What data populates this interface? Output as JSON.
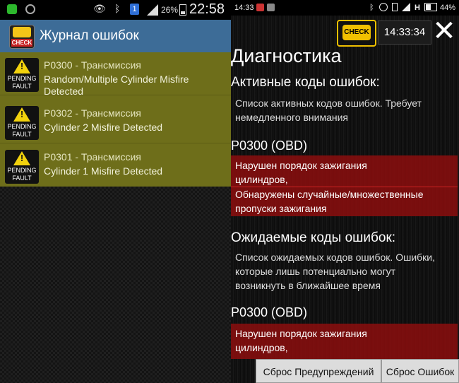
{
  "left": {
    "status_bar": {
      "icons": [
        "green-shield-icon",
        "vpn-icon",
        "eye-icon",
        "bluetooth-icon",
        "sim-icon",
        "signal-icon",
        "battery-icon"
      ],
      "sim_number": "1",
      "battery": "26%",
      "time": "22:58"
    },
    "title": "Журнал ошибок",
    "app_icon": {
      "name": "obd-car-icon",
      "label": "CHECK"
    },
    "faults": [
      {
        "code": "P0300 - Трансмиссия",
        "desc1": "Random/Multiple Cylinder Misfire",
        "desc2": "Detected",
        "badge1": "PENDING",
        "badge2": "FAULT"
      },
      {
        "code": "P0302 - Трансмиссия",
        "desc1": "Cylinder 2 Misfire Detected",
        "desc2": "",
        "badge1": "PENDING",
        "badge2": "FAULT"
      },
      {
        "code": "P0301 - Трансмиссия",
        "desc1": "Cylinder 1 Misfire Detected",
        "desc2": "",
        "badge1": "PENDING",
        "badge2": "FAULT"
      }
    ],
    "colors": {
      "titlebar": "#3d6c97",
      "fault_bg": "#6e6e1a"
    }
  },
  "right": {
    "status_bar": {
      "time": "14:33",
      "network": "H",
      "battery": "44%",
      "icons": [
        "message-icon",
        "play-icon",
        "bluetooth-icon",
        "nfc-icon",
        "vibrate-icon",
        "signal-icon",
        "battery-icon"
      ]
    },
    "check_button": "CHECK",
    "clock": "14:33:34",
    "close_symbol": "✕",
    "title": "Диагностика",
    "active_header": "Активные коды ошибок:",
    "active_text1": "Список активных кодов ошибок. Требует",
    "active_text2": "немедленного внимания",
    "code1": "P0300 (OBD)",
    "code1_lines": [
      "Нарушен порядок зажигания",
      "цилиндров,",
      "Обнаружены случайные/множественные",
      "пропуски зажигания"
    ],
    "pending_header": "Ожидаемые коды ошибок:",
    "pending_text1": "Список ожидаемых кодов ошибок. Ошибки,",
    "pending_text2": "которые лишь потенциально могут",
    "pending_text3": "возникнуть в ближайшее время",
    "code2": "P0300 (OBD)",
    "code2_lines": [
      "Нарушен порядок зажигания",
      "цилиндров,"
    ],
    "btn_reset_warnings": "Сброс Предупреждений",
    "btn_reset_errors": "Сброс Ошибок",
    "colors": {
      "red_box": "#8c0e0e",
      "check_yellow": "#f0c000"
    }
  }
}
